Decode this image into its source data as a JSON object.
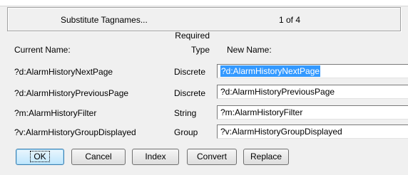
{
  "header": {
    "title": "Substitute Tagnames...",
    "page_counter": "1 of  4"
  },
  "columns": {
    "current_name": "Current Name:",
    "required_type_line1": "Required",
    "required_type_line2": "Type",
    "new_name": "New Name:"
  },
  "rows": [
    {
      "current": "?d:AlarmHistoryNextPage",
      "type": "Discrete",
      "new_name": "?d:AlarmHistoryNextPage",
      "selected": true
    },
    {
      "current": "?d:AlarmHistoryPreviousPage",
      "type": "Discrete",
      "new_name": "?d:AlarmHistoryPreviousPage",
      "selected": false
    },
    {
      "current": "?m:AlarmHistoryFilter",
      "type": "String",
      "new_name": "?m:AlarmHistoryFilter",
      "selected": false
    },
    {
      "current": "?v:AlarmHistoryGroupDisplayed",
      "type": "Group",
      "new_name": "?v:AlarmHistoryGroupDisplayed",
      "selected": false
    }
  ],
  "buttons": {
    "ok": "OK",
    "cancel": "Cancel",
    "index": "Index",
    "convert": "Convert",
    "replace": "Replace"
  },
  "colors": {
    "dialog_bg": "#f0f0f0",
    "selection": "#3399ff",
    "default_button_border": "#3c7fb1"
  }
}
